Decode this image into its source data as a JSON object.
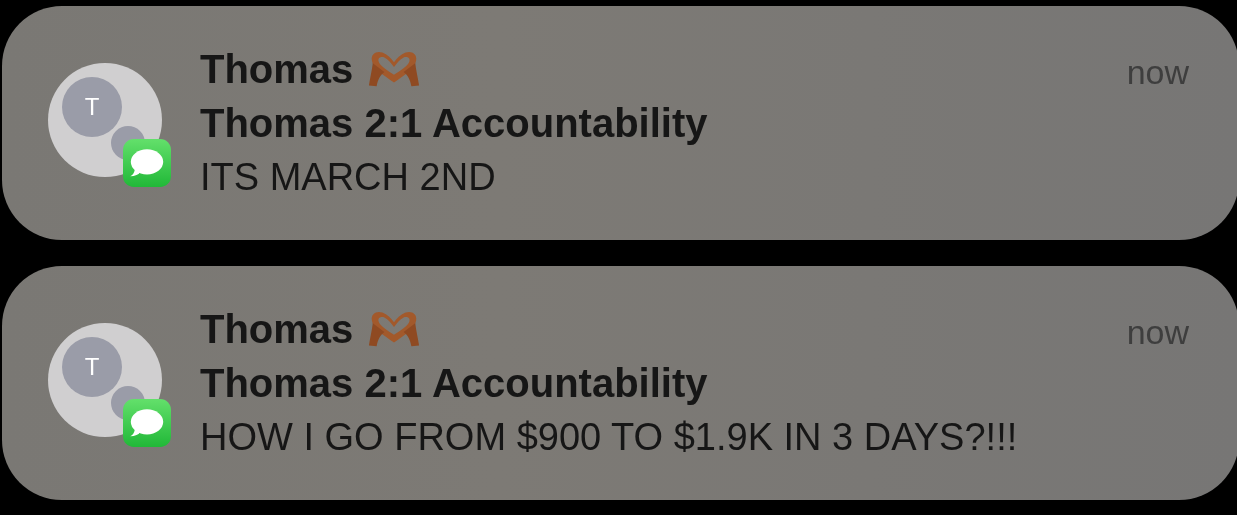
{
  "notifications": [
    {
      "sender": "Thomas",
      "avatar_initial": "T",
      "group": "Thomas 2:1 Accountability",
      "message": "ITS MARCH 2ND",
      "time": "now"
    },
    {
      "sender": "Thomas",
      "avatar_initial": "T",
      "group": "Thomas 2:1 Accountability",
      "message": "HOW I GO FROM $900 TO $1.9K IN 3 DAYS?!!!",
      "time": "now"
    }
  ]
}
